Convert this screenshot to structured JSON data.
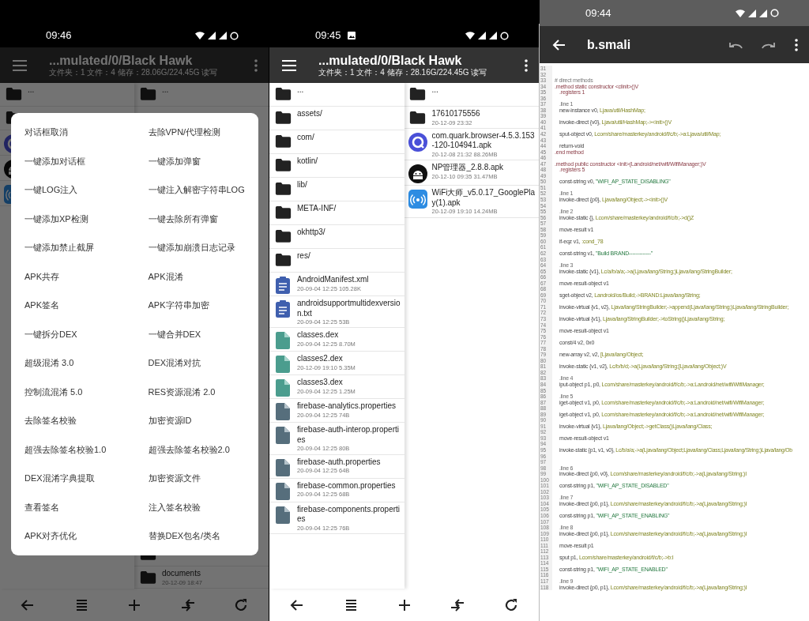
{
  "screens": [
    {
      "kind": "file_manager",
      "dimmed": true,
      "status_bar": {
        "time": "09:46",
        "photo_notice": false
      },
      "toolbar": {
        "title": "...mulated/0/Black Hawk",
        "info": "文件夹：1 文件：4 储存：28.06G/224.45G 读写"
      },
      "panes": [
        {
          "rows": [
            {
              "kind": "folder",
              "name": "..."
            },
            {
              "kind": "folder"
            },
            {
              "kind": "quark"
            },
            {
              "kind": "android"
            },
            {
              "kind": "wifi"
            }
          ]
        },
        {
          "rows": [
            {
              "kind": "folder",
              "name": "..."
            }
          ],
          "bottom_rows": [
            {
              "kind": "folder"
            },
            {
              "kind": "folder",
              "name": "documents",
              "meta": "20-12-09 18:47"
            }
          ]
        }
      ],
      "dialog": {
        "items": [
          "对话框取消",
          "去除VPN/代理检测",
          "一键添加对话框",
          "一键添加弹窗",
          "一键LOG注入",
          "一键注入解密字符串LOG",
          "一键添加XP检测",
          "一键去除所有弹窗",
          "一键添加禁止截屏",
          "一键添加崩溃日志记录",
          "APK共存",
          "APK混淆",
          "APK签名",
          "APK字符串加密",
          "一键拆分DEX",
          "一键合并DEX",
          "超级混淆 3.0",
          "DEX混淆对抗",
          "控制流混淆 5.0",
          "RES资源混淆 2.0",
          "去除签名校验",
          "加密资源ID",
          "超强去除签名校验1.0",
          "超强去除签名校验2.0",
          "DEX混淆字典提取",
          "加密资源文件",
          "查看签名",
          "注入签名校验",
          "APK对齐优化",
          "替换DEX包名/类名"
        ]
      }
    },
    {
      "kind": "file_manager",
      "dimmed": false,
      "status_bar": {
        "time": "09:45",
        "photo_notice": true
      },
      "toolbar": {
        "title": "...mulated/0/Black Hawk",
        "info": "文件夹：1 文件：4 储存：28.16G/224.45G 读写"
      },
      "panes": [
        {
          "rows": [
            {
              "kind": "folder",
              "name": "..."
            },
            {
              "kind": "folder",
              "name": "assets/"
            },
            {
              "kind": "folder",
              "name": "com/"
            },
            {
              "kind": "folder",
              "name": "kotlin/"
            },
            {
              "kind": "folder",
              "name": "lib/"
            },
            {
              "kind": "folder",
              "name": "META-INF/"
            },
            {
              "kind": "folder",
              "name": "okhttp3/"
            },
            {
              "kind": "folder",
              "name": "res/"
            },
            {
              "kind": "document",
              "name": "AndroidManifest.xml",
              "meta": "20-09-04 12:25 105.28K"
            },
            {
              "kind": "document",
              "name": "androidsupportmultidexversion.txt",
              "meta": "20-09-04 12:25 53B"
            },
            {
              "kind": "dex",
              "name": "classes.dex",
              "meta": "20-09-04 12:25 8.70M"
            },
            {
              "kind": "dex",
              "name": "classes2.dex",
              "meta": "20-12-09 19:10 5.35M"
            },
            {
              "kind": "dex",
              "name": "classes3.dex",
              "meta": "20-09-04 12:25 1.25M"
            },
            {
              "kind": "file",
              "name": "firebase-analytics.properties",
              "meta": "20-09-04 12:25 74B"
            },
            {
              "kind": "file",
              "name": "firebase-auth-interop.properties",
              "meta": "20-09-04 12:25 80B"
            },
            {
              "kind": "file",
              "name": "firebase-auth.properties",
              "meta": "20-09-04 12:25 64B"
            },
            {
              "kind": "file",
              "name": "firebase-common.properties",
              "meta": "20-09-04 12:25 68B"
            },
            {
              "kind": "file",
              "name": "firebase-components.properties",
              "meta": "20-09-04 12:25 76B"
            }
          ]
        },
        {
          "rows": [
            {
              "kind": "folder",
              "name": "..."
            },
            {
              "kind": "folder",
              "name": "17610175556",
              "meta": "20-12-09 23:32"
            },
            {
              "kind": "quark",
              "name": "com.quark.browser-4.5.3.153-120-104941.apk",
              "meta": "20-12-08 21:32 88.26MB"
            },
            {
              "kind": "android",
              "name": "NP管理器_2.8.8.apk",
              "meta": "20-12-10 09:35 31.47MB"
            },
            {
              "kind": "wifi",
              "name": "WiFi大师_v5.0.17_GooglePlay(1).apk",
              "meta": "20-12-09 19:10 14.24MB"
            }
          ]
        }
      ]
    },
    {
      "kind": "editor",
      "status_bar": {
        "time": "09:44",
        "photo_notice": false
      },
      "toolbar": {
        "title": "b.smali"
      },
      "lines": [
        {
          "n": "31"
        },
        {
          "n": "32"
        },
        {
          "n": "33",
          "kind": "comment",
          "op": "# direct methods"
        },
        {
          "n": "34",
          "kind": "method",
          "op": ".method static constructor <clinit>()V"
        },
        {
          "n": "35",
          "kind": "directive",
          "op": ".registers 1"
        },
        {
          "n": "36"
        },
        {
          "n": "37",
          "kind": "label",
          "op": ".line 1"
        },
        {
          "n": "38",
          "kind": "code",
          "op": "new-instance v0, ",
          "arg": "Ljava/util/HashMap;"
        },
        {
          "n": "39"
        },
        {
          "n": "40",
          "kind": "code",
          "op": "invoke-direct {v0}, ",
          "arg": "Ljava/util/HashMap;-><init>()V"
        },
        {
          "n": "41"
        },
        {
          "n": "42",
          "kind": "code",
          "op": "sput-object v0, ",
          "arg": "Lcom/share/masterkey/android/f/c/b;->a:Ljava/util/Map;"
        },
        {
          "n": "43"
        },
        {
          "n": "44",
          "kind": "code",
          "op": "return-void"
        },
        {
          "n": "45",
          "kind": "method",
          "op": ".end method"
        },
        {
          "n": "46"
        },
        {
          "n": "47",
          "kind": "method",
          "op": ".method public constructor <init>(Landroid/net/wifi/WifiManager;)V"
        },
        {
          "n": "48",
          "kind": "directive",
          "op": ".registers 5"
        },
        {
          "n": "49"
        },
        {
          "n": "50",
          "kind": "string",
          "op": "const-string v0, ",
          "arg": "\"WIFI_AP_STATE_DISABLING\""
        },
        {
          "n": "51"
        },
        {
          "n": "52",
          "kind": "label",
          "op": ".line 1"
        },
        {
          "n": "53",
          "kind": "code",
          "op": "invoke-direct {p0}, ",
          "arg": "Ljava/lang/Object;-><init>()V"
        },
        {
          "n": "54"
        },
        {
          "n": "55",
          "kind": "label",
          "op": ".line 2"
        },
        {
          "n": "56",
          "kind": "code",
          "op": "invoke-static {}, ",
          "arg": "Lcom/share/masterkey/android/f/c/b;->d()Z"
        },
        {
          "n": "57"
        },
        {
          "n": "58",
          "kind": "code",
          "op": "move-result v1"
        },
        {
          "n": "59"
        },
        {
          "n": "60",
          "kind": "code",
          "op": "if-eqz v1, ",
          "arg": ":cond_78"
        },
        {
          "n": "61"
        },
        {
          "n": "62",
          "kind": "string",
          "op": "const-string v1, ",
          "arg": "\"Build BRAND-------------\""
        },
        {
          "n": "63"
        },
        {
          "n": "64",
          "kind": "label",
          "op": ".line 3"
        },
        {
          "n": "65",
          "kind": "code",
          "op": "invoke-static {v1}, ",
          "arg": "Lc/a/b/a/a;->a(Ljava/lang/String;)Ljava/lang/StringBuilder;"
        },
        {
          "n": "66"
        },
        {
          "n": "67",
          "kind": "code",
          "op": "move-result-object v1"
        },
        {
          "n": "68"
        },
        {
          "n": "69",
          "kind": "code",
          "op": "sget-object v2, ",
          "arg": "Landroid/os/Build;->BRAND:Ljava/lang/String;"
        },
        {
          "n": "70"
        },
        {
          "n": "71",
          "kind": "code",
          "op": "invoke-virtual {v1, v2}, ",
          "arg": "Ljava/lang/StringBuilder;->append(Ljava/lang/String;)Ljava/lang/StringBuilder;"
        },
        {
          "n": "72"
        },
        {
          "n": "73",
          "kind": "code",
          "op": "invoke-virtual {v1}, ",
          "arg": "Ljava/lang/StringBuilder;->toString()Ljava/lang/String;"
        },
        {
          "n": "74"
        },
        {
          "n": "75",
          "kind": "code",
          "op": "move-result-object v1"
        },
        {
          "n": "76"
        },
        {
          "n": "77",
          "kind": "code",
          "op": "const/4 v2, 0x0"
        },
        {
          "n": "78"
        },
        {
          "n": "79",
          "kind": "code",
          "op": "new-array v2, v2, ",
          "arg": "[Ljava/lang/Object;"
        },
        {
          "n": "80"
        },
        {
          "n": "81",
          "kind": "code",
          "op": "invoke-static {v1, v2}, ",
          "arg": "Lc/b/b/d;->a(Ljava/lang/String;[Ljava/lang/Object;)V"
        },
        {
          "n": "82"
        },
        {
          "n": "83",
          "kind": "label",
          "op": ".line 4"
        },
        {
          "n": "84",
          "kind": "code",
          "op": "iput-object p1, p0, ",
          "arg": "Lcom/share/masterkey/android/f/c/b;->a:Landroid/net/wifi/WifiManager;"
        },
        {
          "n": "85"
        },
        {
          "n": "86",
          "kind": "label",
          "op": ".line 5"
        },
        {
          "n": "87",
          "kind": "code",
          "op": "iget-object v1, p0, ",
          "arg": "Lcom/share/masterkey/android/f/c/b;->a:Landroid/net/wifi/WifiManager;"
        },
        {
          "n": "88"
        },
        {
          "n": "89",
          "kind": "code",
          "op": "iget-object v1, p0, ",
          "arg": "Lcom/share/masterkey/android/f/c/b;->a:Landroid/net/wifi/WifiManager;"
        },
        {
          "n": "90"
        },
        {
          "n": "91",
          "kind": "code",
          "op": "invoke-virtual {v1}, ",
          "arg": "Ljava/lang/Object;->getClass()Ljava/lang/Class;"
        },
        {
          "n": "92"
        },
        {
          "n": "93",
          "kind": "code",
          "op": "move-result-object v1"
        },
        {
          "n": "94"
        },
        {
          "n": "95",
          "kind": "code",
          "op": "invoke-static {p1, v1, v0}, ",
          "arg": "Lc/b/a/a;->a(Ljava/lang/Object;Ljava/lang/Class;Ljava/lang/String;)Ljava/lang/Ob"
        },
        {
          "n": "96"
        },
        {
          "n": "97"
        },
        {
          "n": "98",
          "kind": "label",
          "op": ".line 6"
        },
        {
          "n": "99",
          "kind": "code",
          "op": "invoke-direct {p0, v0}, ",
          "arg": "Lcom/share/masterkey/android/f/c/b;->a(Ljava/lang/String;)I"
        },
        {
          "n": "100"
        },
        {
          "n": "101",
          "kind": "string",
          "op": "const-string p1, ",
          "arg": "\"WIFI_AP_STATE_DISABLED\""
        },
        {
          "n": "102"
        },
        {
          "n": "103",
          "kind": "label",
          "op": ".line 7"
        },
        {
          "n": "104",
          "kind": "code",
          "op": "invoke-direct {p0, p1}, ",
          "arg": "Lcom/share/masterkey/android/f/c/b;->a(Ljava/lang/String;)I"
        },
        {
          "n": "105"
        },
        {
          "n": "106",
          "kind": "string",
          "op": "const-string p1, ",
          "arg": "\"WIFI_AP_STATE_ENABLING\""
        },
        {
          "n": "107"
        },
        {
          "n": "108",
          "kind": "label",
          "op": ".line 8"
        },
        {
          "n": "109",
          "kind": "code",
          "op": "invoke-direct {p0, p1}, ",
          "arg": "Lcom/share/masterkey/android/f/c/b;->a(Ljava/lang/String;)I"
        },
        {
          "n": "110"
        },
        {
          "n": "111",
          "kind": "code",
          "op": "move-result p1"
        },
        {
          "n": "112"
        },
        {
          "n": "113",
          "kind": "code",
          "op": "sput p1, ",
          "arg": "Lcom/share/masterkey/android/f/c/b;->b:I"
        },
        {
          "n": "114"
        },
        {
          "n": "115",
          "kind": "string",
          "op": "const-string p1, ",
          "arg": "\"WIFI_AP_STATE_ENABLED\""
        },
        {
          "n": "116"
        },
        {
          "n": "117",
          "kind": "label",
          "op": ".line 9"
        },
        {
          "n": "118",
          "kind": "code",
          "op": "invoke-direct {p0, p1}, ",
          "arg": "Lcom/share/masterkey/android/f/c/b;->a(Ljava/lang/String;)I"
        }
      ]
    }
  ]
}
